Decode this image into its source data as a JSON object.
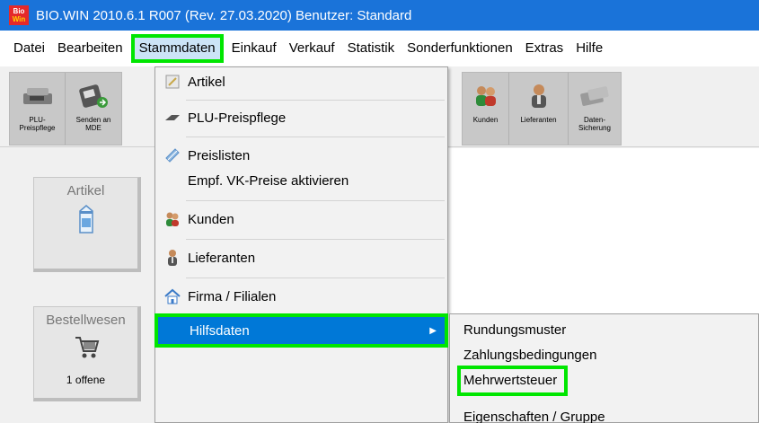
{
  "window": {
    "title": "BIO.WIN 2010.6.1 R007 (Rev. 27.03.2020)  Benutzer: Standard",
    "logo_top": "Bio",
    "logo_bottom": "Win"
  },
  "menubar": {
    "items": [
      "Datei",
      "Bearbeiten",
      "Stammdaten",
      "Einkauf",
      "Verkauf",
      "Statistik",
      "Sonderfunktionen",
      "Extras",
      "Hilfe"
    ],
    "active": "Stammdaten"
  },
  "toolbar": {
    "left_buttons": [
      {
        "label": "PLU-\nPreispflege",
        "icon": "scale-icon"
      },
      {
        "label": "Senden an\nMDE",
        "icon": "handheld-icon"
      }
    ],
    "right_buttons": [
      {
        "label": "Kunden",
        "icon": "people-icon"
      },
      {
        "label": "Lieferanten",
        "icon": "supplier-icon"
      },
      {
        "label": "Daten-\nSicherung",
        "icon": "backup-icon"
      }
    ]
  },
  "tiles": [
    {
      "title": "Artikel",
      "icon": "milk-carton-icon",
      "sub": ""
    },
    {
      "title": "Bestellwesen",
      "icon": "cart-icon",
      "sub": "1 offene"
    }
  ],
  "dropdown": {
    "items": [
      {
        "label": "Artikel",
        "icon": "article-icon"
      },
      {
        "label": "PLU-Preispflege",
        "icon": "scale-icon"
      },
      {
        "label": "Preislisten",
        "icon": "pricelist-icon"
      },
      {
        "label": "Empf. VK-Preise aktivieren",
        "icon": ""
      },
      {
        "label": "Kunden",
        "icon": "people-icon"
      },
      {
        "label": "Lieferanten",
        "icon": "supplier-icon"
      },
      {
        "label": "Firma / Filialen",
        "icon": "house-icon"
      },
      {
        "label": "Hilfsdaten",
        "icon": "",
        "submenu": true
      }
    ]
  },
  "submenu": {
    "items": [
      "Rundungsmuster",
      "Zahlungsbedingungen",
      "Mehrwertsteuer",
      "Eigenschaften / Gruppe"
    ],
    "highlighted": "Mehrwertsteuer"
  },
  "colors": {
    "titlebar": "#1a73d9",
    "highlight_green": "#00e600",
    "selection_blue": "#0078d7"
  }
}
